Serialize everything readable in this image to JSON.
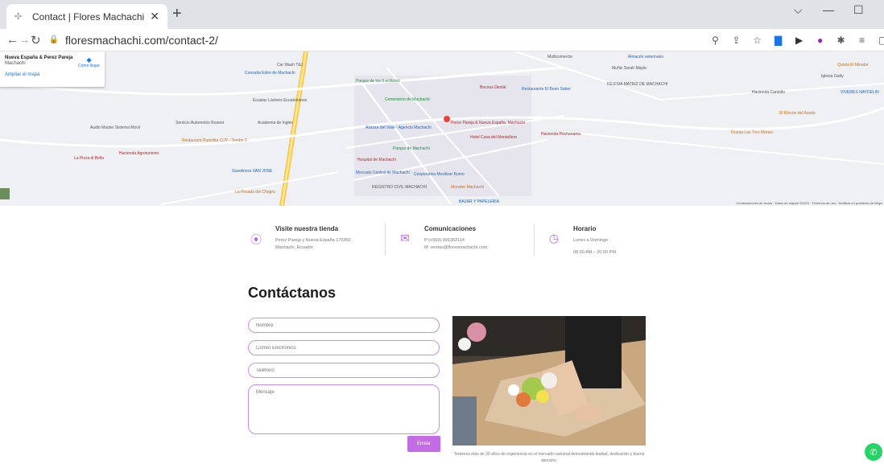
{
  "browser": {
    "tab_title": "Contact | Flores Machachi",
    "url": "floresmachachi.com/contact-2/"
  },
  "map": {
    "card_name": "Nueva España & Perez Pareja",
    "card_sub": "Machachi",
    "card_link": "Ampliar el mapa",
    "card_dir": "Cómo llegar",
    "labels": [
      "Car Wash T&J",
      "Consulta Edén de Machachi",
      "Parque de los 9 aciliares",
      "Cementerio de Machachi",
      "Perez Pareja & Nueva España, Machachi",
      "Parque de Machachi",
      "Hospital de Machachi",
      "Mercado Central de Machachi",
      "Cooperativa Movilizar Rumo",
      "REGISTRO CIVIL MACHACHI",
      "La Posada del Chagra",
      "Gasolinera SAN JOSE",
      "Restaurant Pamelita CUY - Tembo 2",
      "Hacienda Agroturismo",
      "Audio Master Sistema Movil",
      "Servicio Automotriz Rosero",
      "Hacienda Pechanama",
      "IGLESIA MATRIZ DE MACHACHI",
      "Hacienda Cantollo",
      "VIVERES NAYDELIN",
      "Quinta El Mirador",
      "El Rincón del Azado",
      "Granja Las Tres Marias",
      "Iglesia Gatty",
      "La Pizza di Bella",
      "Almacén veterinario",
      "Multicomercio",
      "Muñiz Sarah Mayte",
      "Bocous Dental",
      "Restaurante El Buen Sabor",
      "Hotel Casa del Montañero",
      "BAZAR Y PAPELERIA",
      "Monster Machachi",
      "Academia de Inglés",
      "Alianza del Valle - Agencia Machachi",
      "Ecualac Lácteos Ecuatorianos"
    ],
    "attribution": "Combinaciones de teclas · Datos de mapas ©2023 · Términos de uso · Notificar un problema de Maps"
  },
  "info": [
    {
      "title": "Visite nuestra tienda",
      "line1": "Perez Pareja y Nueva España 170350",
      "line2": "Machachi, Ecuador",
      "icon": "map-pin-icon"
    },
    {
      "title": "Comunicaciones",
      "line1": "P:(+593) 991302114",
      "line2": "M: ventas@floresmachachi.com",
      "icon": "mail-icon"
    },
    {
      "title": "Horario",
      "line1": "Lunes a Domingo",
      "line2": "08:30 AM – 20:00 PM",
      "icon": "clock-icon"
    }
  ],
  "contact": {
    "heading": "Contáctanos",
    "name_ph": "Nombre",
    "email_ph": "Correo Electrónico",
    "phone_ph": "Teléfono",
    "message_ph": "Mensaje",
    "submit": "Enviar",
    "caption": "Tenemos más de 30 años de experiencia en el mercado nacional demostrando lealtad, dedicación y buena atención."
  },
  "colors": {
    "accent": "#c46be6",
    "whatsapp": "#25d366"
  }
}
